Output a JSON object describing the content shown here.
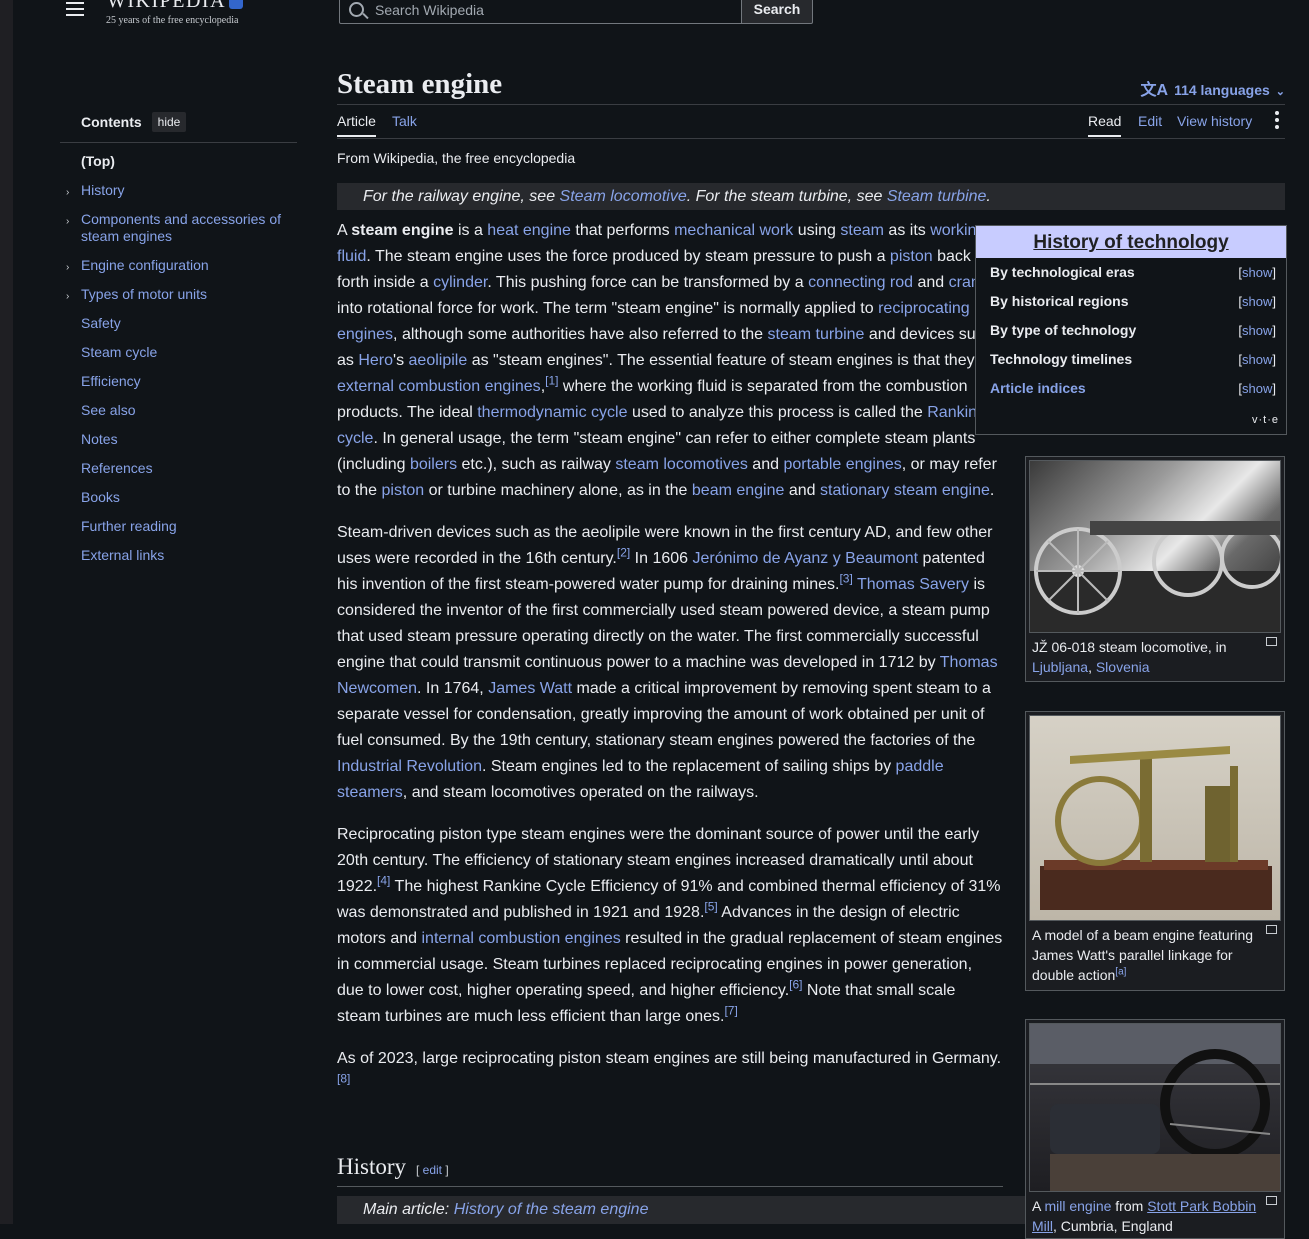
{
  "header": {
    "logo_text": "WIKIPEDIA",
    "tagline": "25 years of the free encyclopedia",
    "search_placeholder": "Search Wikipedia",
    "search_button": "Search"
  },
  "toc": {
    "title": "Contents",
    "hide_label": "hide",
    "items": [
      {
        "label": "(Top)",
        "expandable": false
      },
      {
        "label": "History",
        "expandable": true
      },
      {
        "label": "Components and accessories of steam engines",
        "expandable": true
      },
      {
        "label": "Engine configuration",
        "expandable": true
      },
      {
        "label": "Types of motor units",
        "expandable": true
      },
      {
        "label": "Safety",
        "expandable": false
      },
      {
        "label": "Steam cycle",
        "expandable": false
      },
      {
        "label": "Efficiency",
        "expandable": false
      },
      {
        "label": "See also",
        "expandable": false
      },
      {
        "label": "Notes",
        "expandable": false
      },
      {
        "label": "References",
        "expandable": false
      },
      {
        "label": "Books",
        "expandable": false
      },
      {
        "label": "Further reading",
        "expandable": false
      },
      {
        "label": "External links",
        "expandable": false
      }
    ]
  },
  "page": {
    "title": "Steam engine",
    "languages": "114 languages",
    "tabs": {
      "article": "Article",
      "talk": "Talk",
      "read": "Read",
      "edit": "Edit",
      "history": "View history"
    },
    "from": "From Wikipedia, the free encyclopedia",
    "hatnote": {
      "pre": "For the railway engine, see ",
      "link1": "Steam locomotive",
      "mid": ". For the steam turbine, see ",
      "link2": "Steam turbine",
      "post": "."
    }
  },
  "navbox": {
    "title": "History of technology",
    "rows": [
      {
        "label": "By technological eras",
        "action": "show"
      },
      {
        "label": "By historical regions",
        "action": "show"
      },
      {
        "label": "By type of technology",
        "action": "show"
      },
      {
        "label": "Technology timelines",
        "action": "show"
      },
      {
        "label": "Article indices",
        "action": "show"
      }
    ],
    "vte": "v·t·e"
  },
  "section": {
    "title": "History",
    "edit": "edit",
    "main_pre": "Main article: ",
    "main_link": "History of the steam engine"
  },
  "thumbs": [
    {
      "caption_text": "JŽ 06-018 steam locomotive, in ",
      "link1": "Ljubljana",
      "sep": ", ",
      "link2": "Slovenia"
    },
    {
      "caption_text": "A model of a beam engine featuring James Watt's parallel linkage for double action",
      "note": "[a]"
    },
    {
      "pre": "A ",
      "link1": "mill engine",
      "mid": " from ",
      "link2": "Stott Park Bobbin Mill",
      "post": ", Cumbria, England"
    }
  ]
}
